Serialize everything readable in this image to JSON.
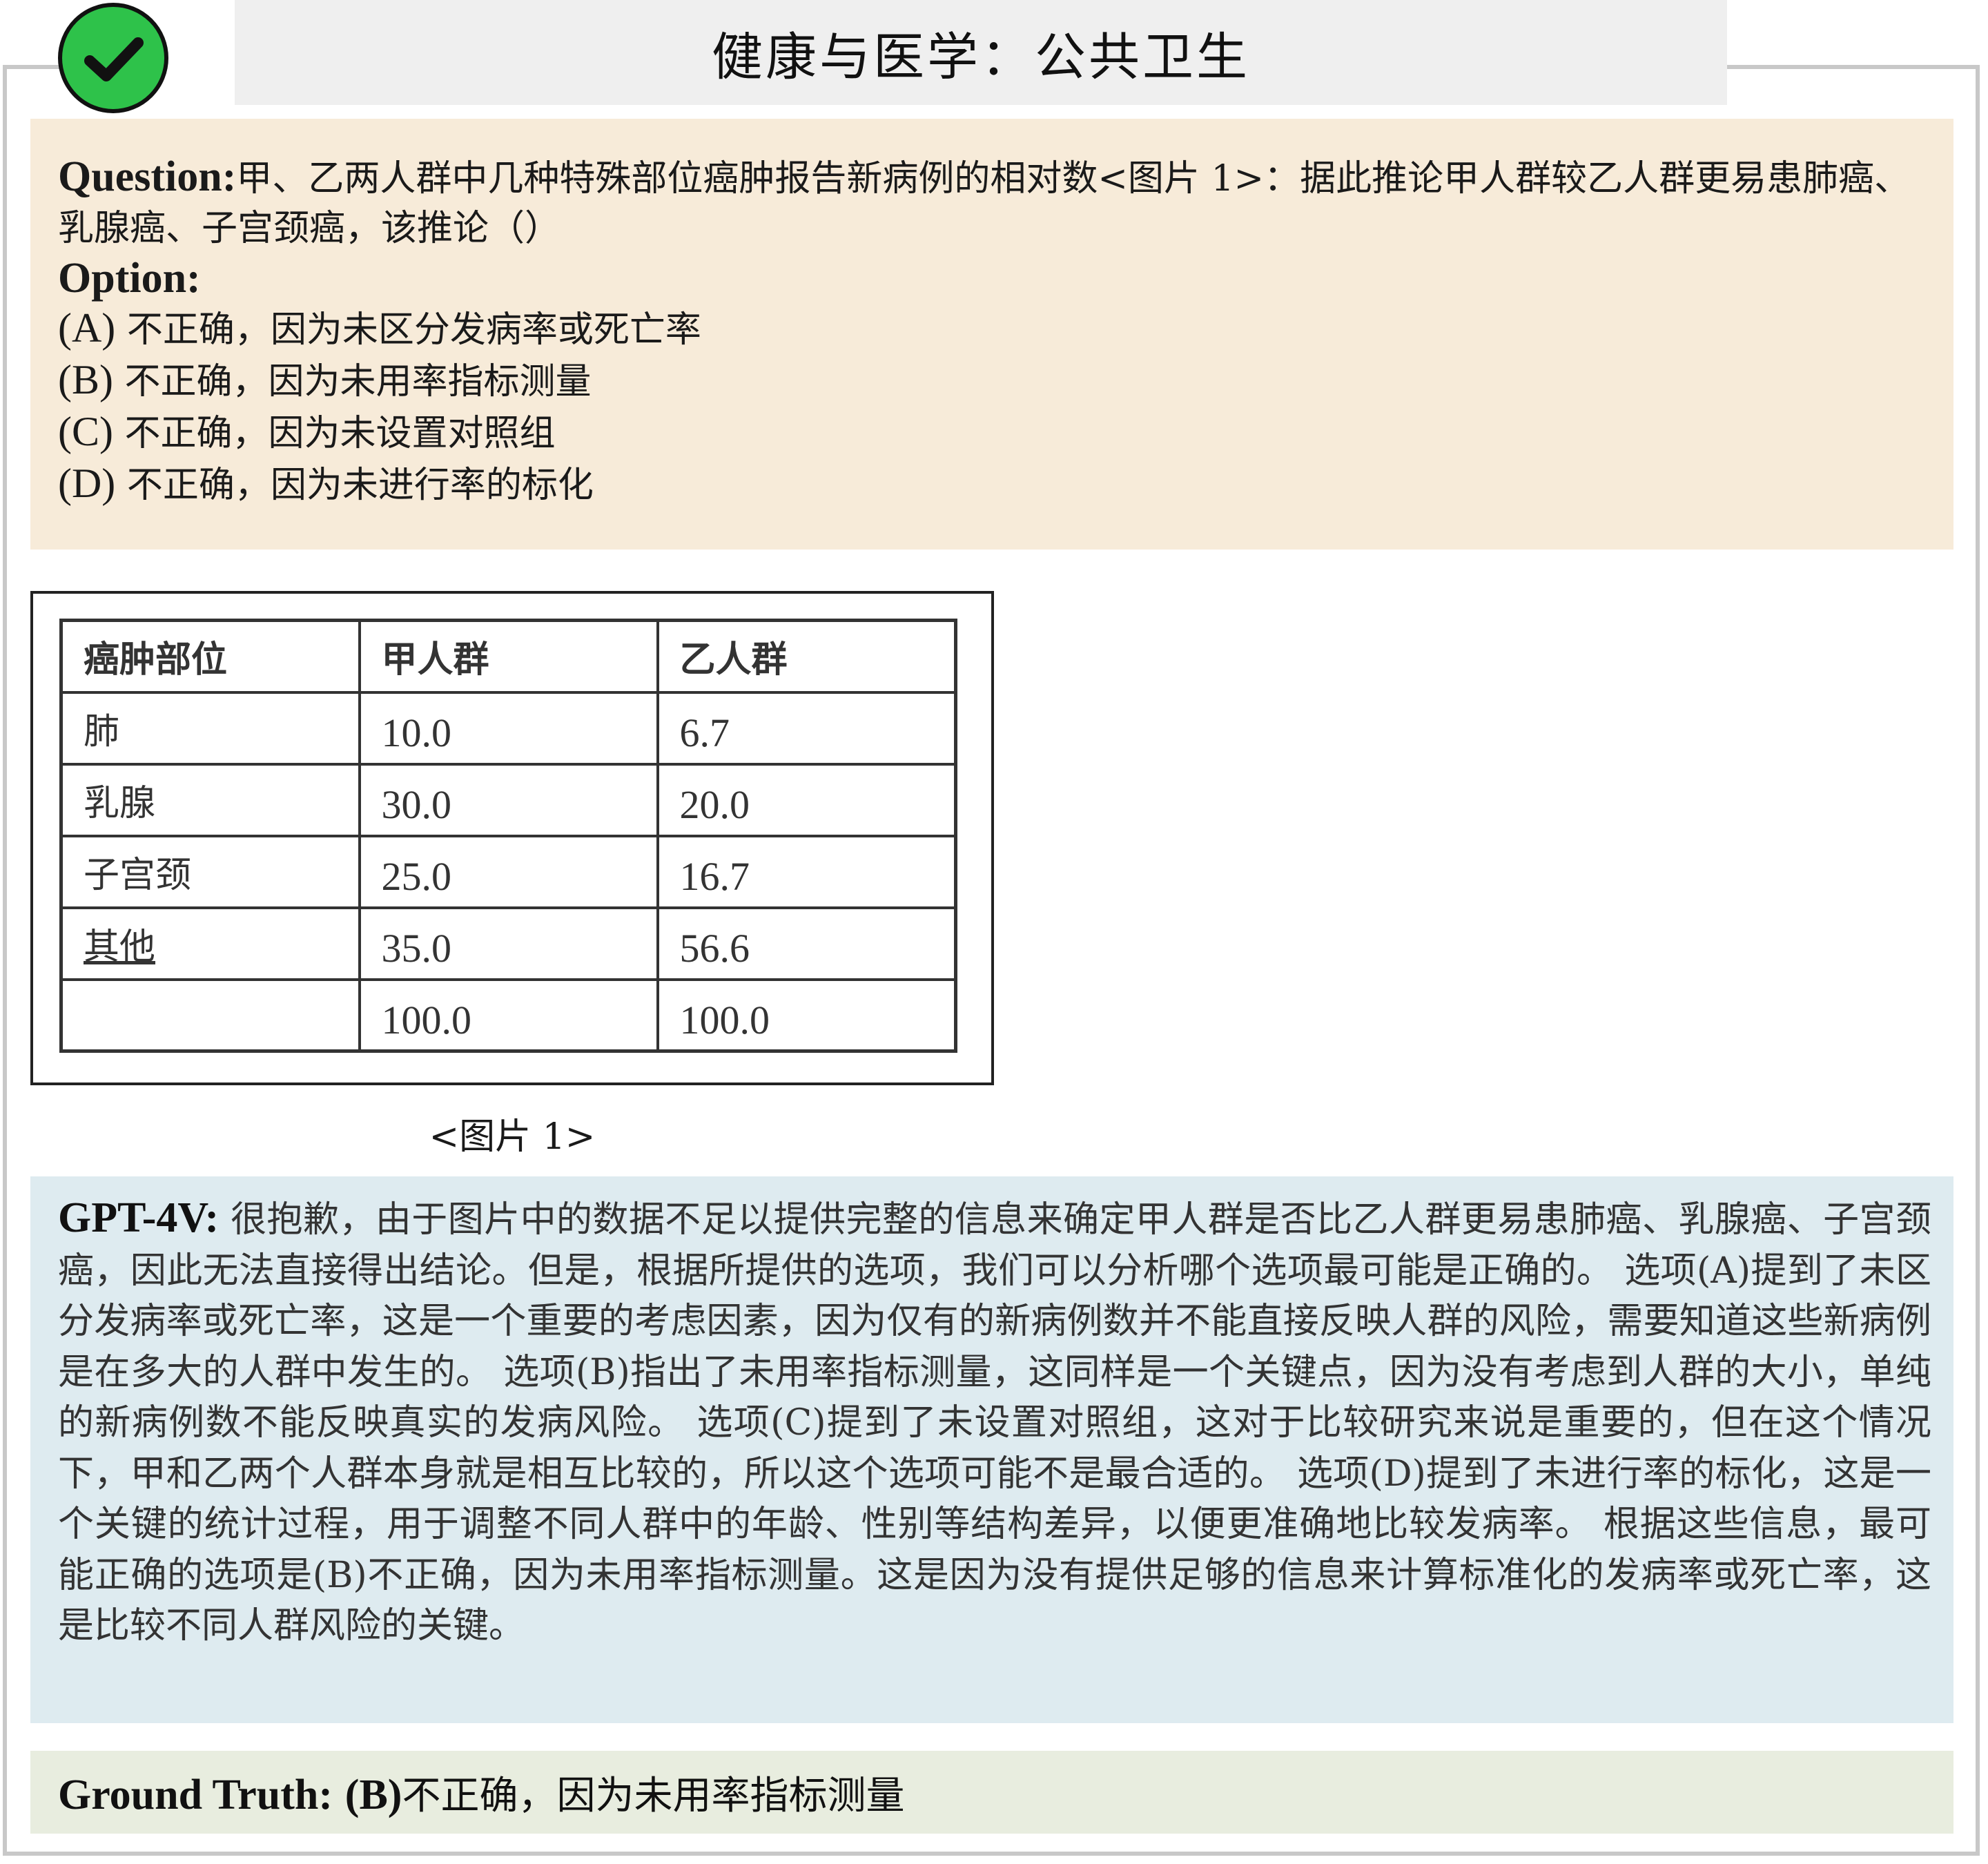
{
  "header": {
    "title": "健康与医学：公共卫生"
  },
  "question": {
    "label": "Question:",
    "text": "甲、乙两人群中几种特殊部位癌肿报告新病例的相对数<图片 1>：据此推论甲人群较乙人群更易患肺癌、乳腺癌、子宫颈癌，该推论（）",
    "option_label": "Option:",
    "options": [
      {
        "key": "(A)",
        "text": "不正确，因为未区分发病率或死亡率"
      },
      {
        "key": "(B)",
        "text": "不正确，因为未用率指标测量"
      },
      {
        "key": "(C)",
        "text": "不正确，因为未设置对照组"
      },
      {
        "key": "(D)",
        "text": "不正确，因为未进行率的标化"
      }
    ]
  },
  "figure": {
    "caption": "<图片 1>",
    "table": {
      "headers": [
        "癌肿部位",
        "甲人群",
        "乙人群"
      ],
      "rows": [
        [
          "肺",
          "10.0",
          "6.7"
        ],
        [
          "乳腺",
          "30.0",
          "20.0"
        ],
        [
          "子宫颈",
          "25.0",
          "16.7"
        ],
        [
          "其他",
          "35.0",
          "56.6"
        ],
        [
          "",
          "100.0",
          "100.0"
        ]
      ]
    }
  },
  "answer": {
    "label": "GPT-4V:",
    "text": "很抱歉，由于图片中的数据不足以提供完整的信息来确定甲人群是否比乙人群更易患肺癌、乳腺癌、子宫颈癌，因此无法直接得出结论。但是，根据所提供的选项，我们可以分析哪个选项最可能是正确的。 选项(A)提到了未区分发病率或死亡率，这是一个重要的考虑因素，因为仅有的新病例数并不能直接反映人群的风险，需要知道这些新病例是在多大的人群中发生的。 选项(B)指出了未用率指标测量，这同样是一个关键点，因为没有考虑到人群的大小，单纯的新病例数不能反映真实的发病风险。 选项(C)提到了未设置对照组，这对于比较研究来说是重要的，但在这个情况下，甲和乙两个人群本身就是相互比较的，所以这个选项可能不是最合适的。 选项(D)提到了未进行率的标化，这是一个关键的统计过程，用于调整不同人群中的年龄、性别等结构差异，以便更准确地比较发病率。 根据这些信息，最可能正确的选项是(B)不正确，因为未用率指标测量。这是因为没有提供足够的信息来计算标准化的发病率或死亡率，这是比较不同人群风险的关键。"
  },
  "ground_truth": {
    "label": "Ground Truth:",
    "key": "(B)",
    "text": "不正确，因为未用率指标测量"
  },
  "colors": {
    "question_bg": "#f7ebd9",
    "answer_bg": "#deebf0",
    "ground_truth_bg": "#e8eddf",
    "check_green": "#2ec24a"
  },
  "icons": {
    "status": "check-circle-icon"
  }
}
